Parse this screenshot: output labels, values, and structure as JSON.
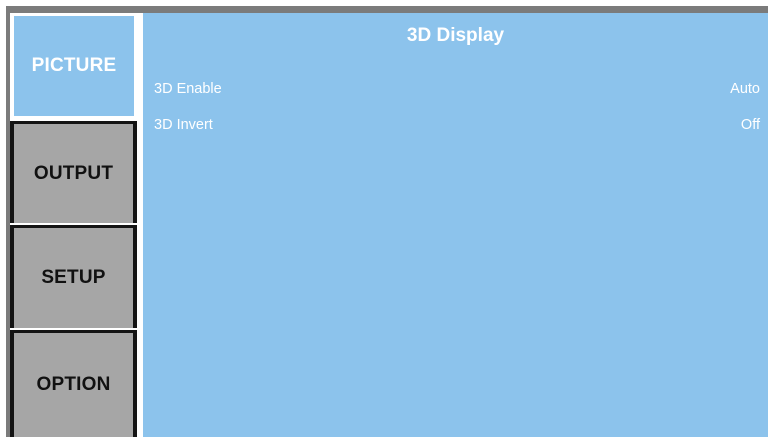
{
  "tabs": [
    {
      "label": "PICTURE",
      "active": true
    },
    {
      "label": "OUTPUT",
      "active": false
    },
    {
      "label": "SETUP",
      "active": false
    },
    {
      "label": "OPTION",
      "active": false
    }
  ],
  "panel": {
    "title": "3D Display",
    "settings": [
      {
        "label": "3D Enable",
        "value": "Auto"
      },
      {
        "label": "3D Invert",
        "value": "Off"
      }
    ]
  },
  "colors": {
    "active_tab": "#8cc3ec",
    "panel_background": "#8cc3ec",
    "inactive_tab": "#a6a6a6",
    "tab_border": "#141414",
    "frame": "#7b7b7b",
    "text_light": "#ffffff",
    "text_dark": "#111111"
  }
}
